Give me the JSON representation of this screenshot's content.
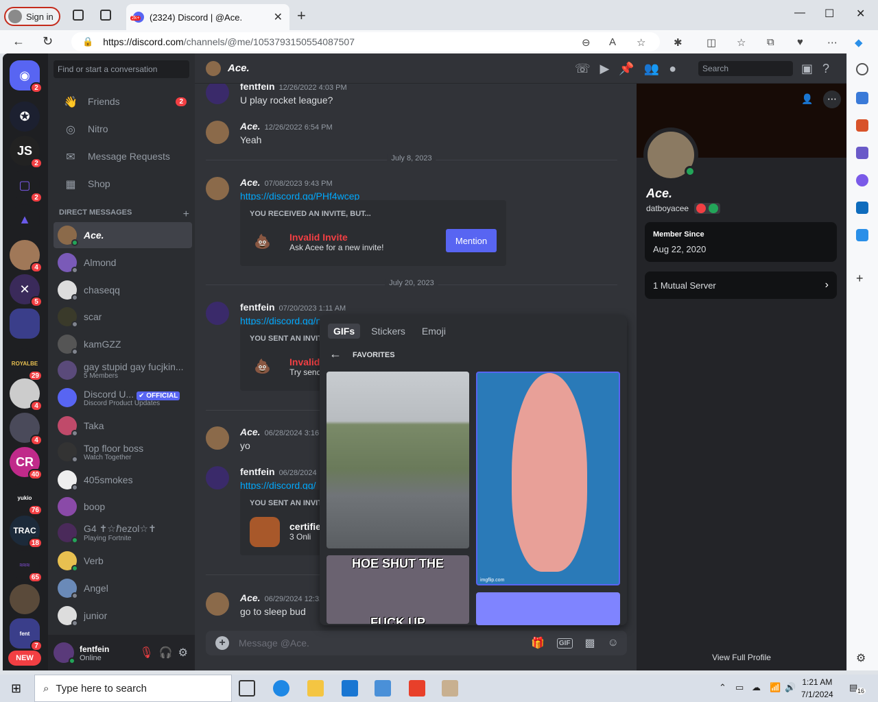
{
  "browser": {
    "signin_label": "Sign in",
    "tab_title": "(2324) Discord | @Ace.",
    "tab_badge": "2k+",
    "url_host": "https://discord.com",
    "url_path": "/channels/@me/1053793150554087507"
  },
  "discord": {
    "find_placeholder": "Find or start a conversation",
    "nav": [
      {
        "label": "Friends",
        "badge": "2",
        "icon": "friends-icon"
      },
      {
        "label": "Nitro",
        "icon": "nitro-icon"
      },
      {
        "label": "Message Requests",
        "icon": "mail-icon"
      },
      {
        "label": "Shop",
        "icon": "shop-icon"
      }
    ],
    "dm_header": "DIRECT MESSAGES",
    "dm_add": "+",
    "dms": [
      {
        "name": "Ace.",
        "selected": true,
        "online": true
      },
      {
        "name": "Almond"
      },
      {
        "name": "chaseqq"
      },
      {
        "name": "scar"
      },
      {
        "name": "kamGZZ"
      },
      {
        "name": "gay stupid gay fucjkin...",
        "sub": "5 Members"
      },
      {
        "name": "Discord U...",
        "sub": "Discord Product Updates",
        "badge": "✔ OFFICIAL"
      },
      {
        "name": "Taka"
      },
      {
        "name": "Top floor boss",
        "sub": "Watch Together"
      },
      {
        "name": "405smokes"
      },
      {
        "name": "boop"
      },
      {
        "name": "G4 ✝☆ℏezol☆✝",
        "sub": "Playing Fortnite"
      },
      {
        "name": "Verb"
      },
      {
        "name": "Angel"
      },
      {
        "name": "junior"
      }
    ],
    "user": {
      "name": "fentfein",
      "status": "Online"
    },
    "guild_badges": [
      "2",
      "",
      "2",
      "2",
      "",
      "4",
      "5",
      "",
      "29",
      "4",
      "4",
      "40",
      "76",
      "18",
      "65",
      "",
      "7"
    ],
    "new_label": "NEW",
    "channel": {
      "name": "Ace.",
      "search_placeholder": "Search"
    },
    "messages": [
      {
        "author": "fentfein",
        "time": "12/26/2022 4:03 PM",
        "text": "U play rocket league?"
      },
      {
        "author": "Ace.",
        "time": "12/26/2022 6:54 PM",
        "text": "Yeah"
      },
      {
        "divider": "July 8, 2023"
      },
      {
        "author": "Ace.",
        "time": "07/08/2023 9:43 PM",
        "link": "https://discord.gg/PHf4wcep"
      },
      {
        "divider": "July 20, 2023"
      },
      {
        "author": "fentfein",
        "time": "07/20/2023 1:11 AM",
        "link": "https://discord.gg/nPZYuv6N"
      },
      {
        "author": "Ace.",
        "time": "06/28/2024 3:16 AM",
        "text": "yo"
      },
      {
        "author": "fentfein",
        "time": "06/28/2024",
        "link": "https://discord.gg/"
      },
      {
        "author": "Ace.",
        "time": "06/29/2024 12:32",
        "text": "go to sleep bud"
      }
    ],
    "invite1": {
      "title": "YOU RECEIVED AN INVITE, BUT...",
      "status": "Invalid Invite",
      "sub": "Ask Acee for a new invite!",
      "button": "Mention"
    },
    "invite2": {
      "title": "YOU SENT AN INVITE...",
      "status": "Invalid",
      "sub": "Try send"
    },
    "invite3": {
      "title": "YOU SENT AN INVITE...",
      "server": "certifie",
      "online": "3 Onli"
    },
    "composer_placeholder": "Message @Ace.",
    "gif_picker": {
      "tabs": [
        "GIFs",
        "Stickers",
        "Emoji"
      ],
      "section": "FAVORITES",
      "caption": "HOE SHUT THE",
      "caption2": "FUCK UP",
      "watermark": "imgflip.com"
    },
    "profile": {
      "name": "Ace.",
      "username": "datboyacee",
      "member_since_label": "Member Since",
      "member_since": "Aug 22, 2020",
      "mutual": "1 Mutual Server",
      "footer": "View Full Profile"
    }
  },
  "taskbar": {
    "search_placeholder": "Type here to search",
    "time": "1:21 AM",
    "date": "7/1/2024",
    "notif": "16"
  },
  "colors": {
    "blurple": "#5865f2",
    "red": "#f23f43",
    "green": "#23a559",
    "link": "#00a8fc"
  }
}
